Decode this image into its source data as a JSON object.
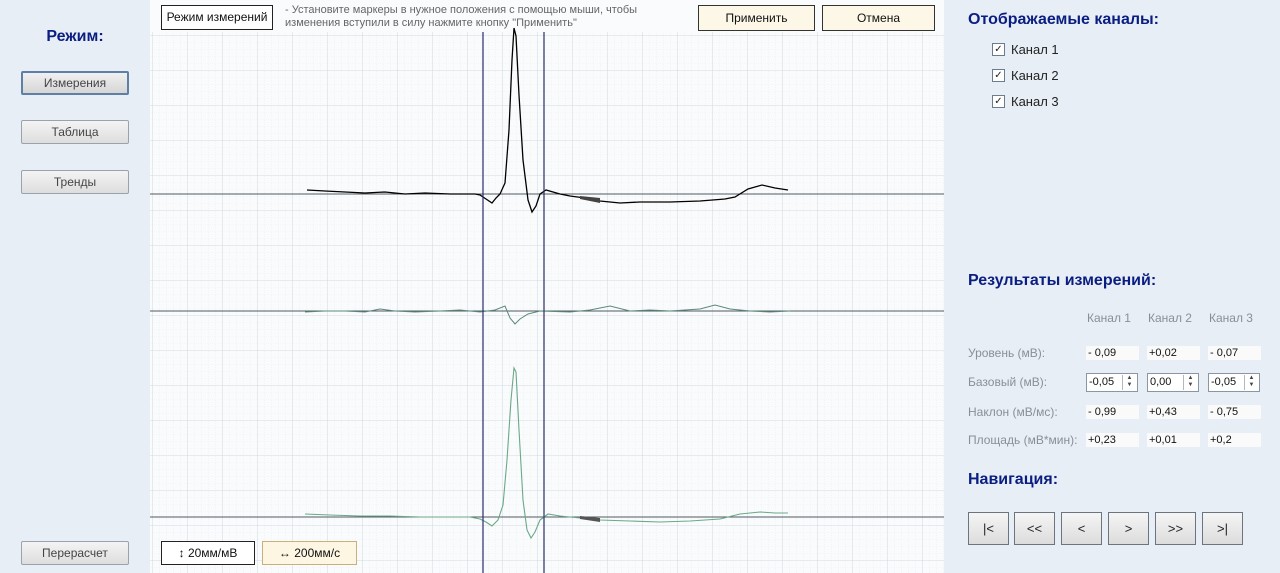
{
  "sidebar": {
    "title": "Режим:",
    "buttons": {
      "measure": "Измерения",
      "table": "Таблица",
      "trends": "Тренды"
    },
    "recalc": "Перерасчет"
  },
  "chart": {
    "mode_label": "Режим измерений",
    "hint": "- Установите маркеры в нужное положения с помощью мыши, чтобы изменения вступили в силу нажмите кнопку \"Применить\"",
    "apply": "Применить",
    "cancel": "Отмена",
    "scale_v": "↕ 20мм/мВ",
    "scale_h": "↔ 200мм/с",
    "colors": {
      "grid": "#c8d2dc",
      "channel1": "#000000",
      "channel2": "#5a8a7a",
      "channel3": "#6aa888",
      "marker": "#2a2d6b"
    }
  },
  "channels_panel": {
    "title": "Отображаемые каналы:",
    "items": [
      {
        "label": "Канал 1",
        "checked": true
      },
      {
        "label": "Канал 2",
        "checked": true
      },
      {
        "label": "Канал 3",
        "checked": true
      }
    ]
  },
  "results": {
    "title": "Результаты измерений:",
    "headers": [
      "Канал 1",
      "Канал 2",
      "Канал 3"
    ],
    "rows": {
      "level": {
        "label": "Уровень (мВ):",
        "values": [
          "- 0,09",
          "+0,02",
          "- 0,07"
        ]
      },
      "base": {
        "label": "Базовый (мВ):",
        "values": [
          "-0,05",
          "0,00",
          "-0,05"
        ]
      },
      "slope": {
        "label": "Наклон (мВ/мс):",
        "values": [
          "- 0,99",
          "+0,43",
          "- 0,75"
        ]
      },
      "area": {
        "label": "Площадь (мВ*мин):",
        "values": [
          "+0,23",
          "+0,01",
          "+0,2"
        ]
      }
    }
  },
  "navigation": {
    "title": "Навигация:",
    "first": "|<",
    "fast_back": "<<",
    "back": "<",
    "forward": ">",
    "fast_forward": ">>",
    "last": ">|"
  }
}
